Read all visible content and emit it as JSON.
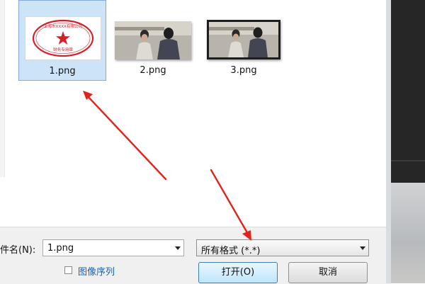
{
  "files": [
    {
      "name": "1.png",
      "selected": true,
      "kind": "stamp"
    },
    {
      "name": "2.png",
      "selected": false,
      "kind": "photo"
    },
    {
      "name": "3.png",
      "selected": false,
      "kind": "photo"
    }
  ],
  "stamp_text": {
    "ring": "上海市XXXX有限公司",
    "bottom": "财务专用章"
  },
  "filename": {
    "label": "件名(N):",
    "value": "1.png"
  },
  "filetype": {
    "value": "所有格式 (*.*)"
  },
  "image_sequence": {
    "label": "图像序列",
    "checked": false
  },
  "buttons": {
    "open": "打开(O)",
    "cancel": "取消"
  },
  "colors": {
    "selection_bg": "#cde3f7",
    "selection_border": "#84acdd",
    "stamp_red": "#d41f26",
    "arrow_red": "#e32219",
    "link_blue": "#1a5fb4"
  },
  "icons": [
    "dropdown-arrow-icon",
    "checkbox-icon",
    "stamp-icon"
  ]
}
